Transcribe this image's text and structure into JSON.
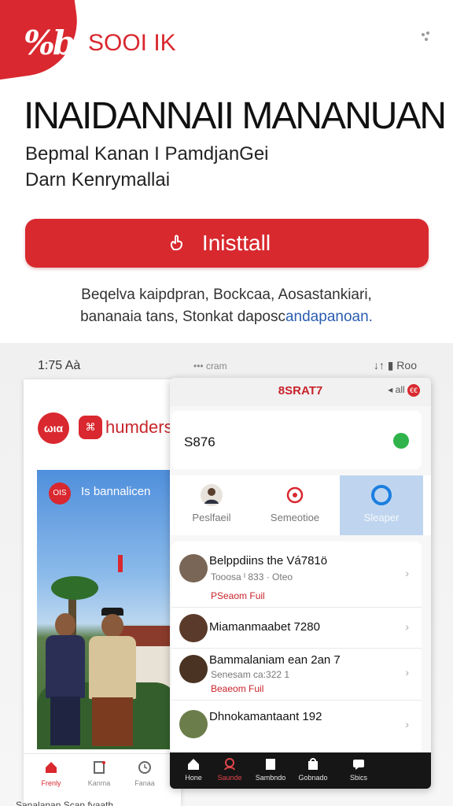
{
  "store_header": {
    "logo_text": "%b",
    "brand": "SOOI IK",
    "more_icon": "more-dots-icon"
  },
  "app": {
    "title": "INAIDANNAII MANANUAN",
    "subtitle_line1": "Bepmal Kanan I PamdjanGei",
    "subtitle_line2": "Darn Kenrymallai",
    "install_label": "Inisttall",
    "install_icon": "hand-icon"
  },
  "note": {
    "line1": "Beqelva kaipdpran, Bockcaa, Aosastankiari,",
    "line2_text": "bananaia tans, Stonkat daposc",
    "line2_link": "andapanoan."
  },
  "status_bar": {
    "time": "1:75 Aà",
    "center": "••• cram",
    "right": "↓↑ ▮ Roo"
  },
  "back_screen": {
    "logo_text": "ωια",
    "brand": "humders",
    "photo_caption": "Is bannalicen",
    "photo_tag": "OIS",
    "nav": [
      {
        "label": "Frenly",
        "icon": "home-icon",
        "active": true
      },
      {
        "label": "Kanma",
        "icon": "document-icon",
        "active": false
      },
      {
        "label": "Fanaa",
        "icon": "clock-icon",
        "active": false
      }
    ],
    "bottom_text": "Sanalanan Scan fyaath"
  },
  "front_screen": {
    "title": "8SRAT7",
    "status_right": "◂ all",
    "status_badge": "€€",
    "card_value": "S876",
    "tabs": [
      {
        "label": "Peslfaeil",
        "icon": "person-icon",
        "active": false
      },
      {
        "label": "Semeotioe",
        "icon": "target-icon",
        "active": false
      },
      {
        "label": "Sleaper",
        "icon": "circle-icon",
        "active": true
      }
    ],
    "contacts": [
      {
        "name": "Belppdiins  the Vá781ö",
        "meta": "Tooosa ᴵ 833 · Oteo",
        "tag": "PSeaom Fuil"
      },
      {
        "name": "Miamanmaabet 7280",
        "meta": "",
        "tag": ""
      },
      {
        "name": "Bammalaniam ean 2an 7",
        "meta": "Senesam ca:322 1",
        "tag": "Beaeom Fuil"
      },
      {
        "name": "Dhnokamantaant 192",
        "meta": "",
        "tag": ""
      }
    ],
    "nav": [
      {
        "label": "Hone",
        "icon": "home-icon",
        "active": false
      },
      {
        "label": "Saunde",
        "icon": "person-icon",
        "active": true
      },
      {
        "label": "Sambndo",
        "icon": "book-icon",
        "active": false
      },
      {
        "label": "Gobnado",
        "icon": "bag-icon",
        "active": false
      },
      {
        "label": "Sbics",
        "icon": "chat-icon",
        "active": false
      }
    ]
  },
  "colors": {
    "accent": "#d9282f",
    "link": "#2a5db0",
    "active_tab": "#bfd5ef",
    "nav_dark": "#161616"
  }
}
